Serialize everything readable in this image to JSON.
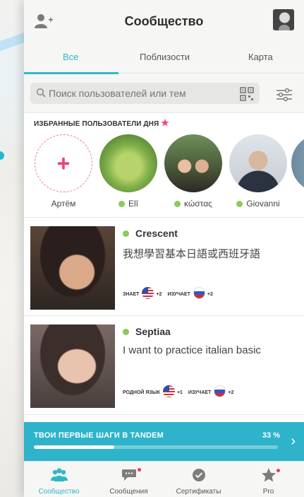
{
  "header": {
    "title": "Сообщество"
  },
  "tabs": [
    {
      "label": "Все",
      "active": true
    },
    {
      "label": "Поблизости",
      "active": false
    },
    {
      "label": "Карта",
      "active": false
    }
  ],
  "search": {
    "placeholder": "Поиск пользователей или тем"
  },
  "featured": {
    "label": "ИЗБРАННЫЕ ПОЛЬЗОВАТЕЛИ ДНЯ",
    "users": [
      {
        "name": "Артём",
        "online": false
      },
      {
        "name": "Elî",
        "online": true
      },
      {
        "name": "κώστας",
        "online": true
      },
      {
        "name": "Giovanni",
        "online": true
      }
    ]
  },
  "cards": [
    {
      "name": "Crescent",
      "bio": "我想學習基本日語或西班牙語",
      "lang_label_1": "ЗНАЕТ",
      "lang_1_more": "+2",
      "lang_label_2": "ИЗУЧАЕТ",
      "lang_2_more": "+2"
    },
    {
      "name": "Septiaa",
      "bio": "I want to practice italian basic",
      "lang_label_1": "РОДНОЙ ЯЗЫК",
      "lang_1_more": "+1",
      "lang_label_2": "ИЗУЧАЕТ",
      "lang_2_more": "+2"
    }
  ],
  "progress": {
    "title": "ТВОИ ПЕРВЫЕ ШАГИ В TANDEM",
    "percent_label": "33 %",
    "value": 0.33
  },
  "bottom_nav": [
    {
      "label": "Сообщество",
      "icon": "community-icon",
      "active": true
    },
    {
      "label": "Сообщения",
      "icon": "messages-icon",
      "active": false
    },
    {
      "label": "Сертификаты",
      "icon": "certificate-icon",
      "active": false
    },
    {
      "label": "Pro",
      "icon": "star-icon",
      "active": false
    }
  ],
  "colors": {
    "accent": "#2fb7c8",
    "pink": "#ee3e72",
    "online": "#8acb5a",
    "banner": "#2eb3ca"
  }
}
